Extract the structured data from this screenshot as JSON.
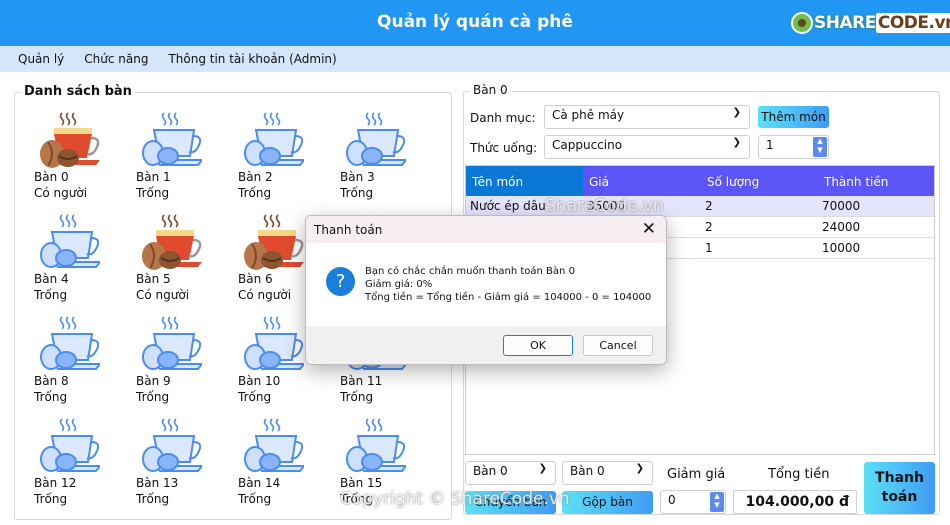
{
  "header": {
    "title": "Quản lý quán cà phê",
    "logo": "SHARECODE.vn"
  },
  "menu": [
    "Quản lý",
    "Chức năng",
    "Thông tin tài khoản (Admin)"
  ],
  "tables_panel": {
    "title": "Danh sách bàn",
    "tables": [
      {
        "name": "Bàn 0",
        "status": "Có người",
        "occupied": true
      },
      {
        "name": "Bàn 1",
        "status": "Trống",
        "occupied": false
      },
      {
        "name": "Bàn 2",
        "status": "Trống",
        "occupied": false
      },
      {
        "name": "Bàn 3",
        "status": "Trống",
        "occupied": false
      },
      {
        "name": "Bàn 4",
        "status": "Trống",
        "occupied": false
      },
      {
        "name": "Bàn 5",
        "status": "Có người",
        "occupied": true
      },
      {
        "name": "Bàn 6",
        "status": "Có người",
        "occupied": true
      },
      {
        "name": "",
        "status": "",
        "occupied": false
      },
      {
        "name": "Bàn 8",
        "status": "Trống",
        "occupied": false
      },
      {
        "name": "Bàn 9",
        "status": "Trống",
        "occupied": false
      },
      {
        "name": "Bàn 10",
        "status": "Trống",
        "occupied": false
      },
      {
        "name": "Bàn 11",
        "status": "Trống",
        "occupied": false
      },
      {
        "name": "Bàn 12",
        "status": "Trống",
        "occupied": false
      },
      {
        "name": "Bàn 13",
        "status": "Trống",
        "occupied": false
      },
      {
        "name": "Bàn 14",
        "status": "Trống",
        "occupied": false
      },
      {
        "name": "Bàn 15",
        "status": "Trống",
        "occupied": false
      }
    ]
  },
  "order": {
    "title": "Bàn 0",
    "category_label": "Danh mục:",
    "category_value": "Cà phê máy",
    "add_button": "Thêm món",
    "drink_label": "Thức uống:",
    "drink_value": "Cappuccino",
    "quantity": "1",
    "columns": [
      "Tên món",
      "Giá",
      "Số lượng",
      "Thành tiền"
    ],
    "rows": [
      [
        "Nước ép dâu",
        "35000",
        "2",
        "70000"
      ],
      [
        "",
        "",
        "2",
        "24000"
      ],
      [
        "",
        "",
        "1",
        "10000"
      ]
    ],
    "switch_from": "Bàn 0",
    "switch_to": "Bàn 0",
    "switch_button": "Chuyển bàn",
    "merge_button": "Gộp bàn",
    "discount_label": "Giảm giá",
    "discount_value": "0",
    "total_label": "Tổng tiền",
    "total_value": "104.000,00 đ",
    "pay_button_line1": "Thanh",
    "pay_button_line2": "toán"
  },
  "dialog": {
    "title": "Thanh toán",
    "line1": "Bạn có chắc chắn muốn thanh toán Bàn 0",
    "line2": "Giảm giá: 0%",
    "line3": "Tổng tiền = Tổng tiền - Giảm giá = 104000 - 0 = 104000",
    "ok": "OK",
    "cancel": "Cancel",
    "icon": "question-icon"
  },
  "watermarks": [
    "ShareCode.vn",
    "Copyright © ShareCode.vn"
  ],
  "colors": {
    "header": "#2196f3",
    "grid_header_first": "#0a78d4",
    "grid_header": "#5b55f5",
    "occupied": "#e04a2f",
    "empty": "#4a8cf0"
  }
}
